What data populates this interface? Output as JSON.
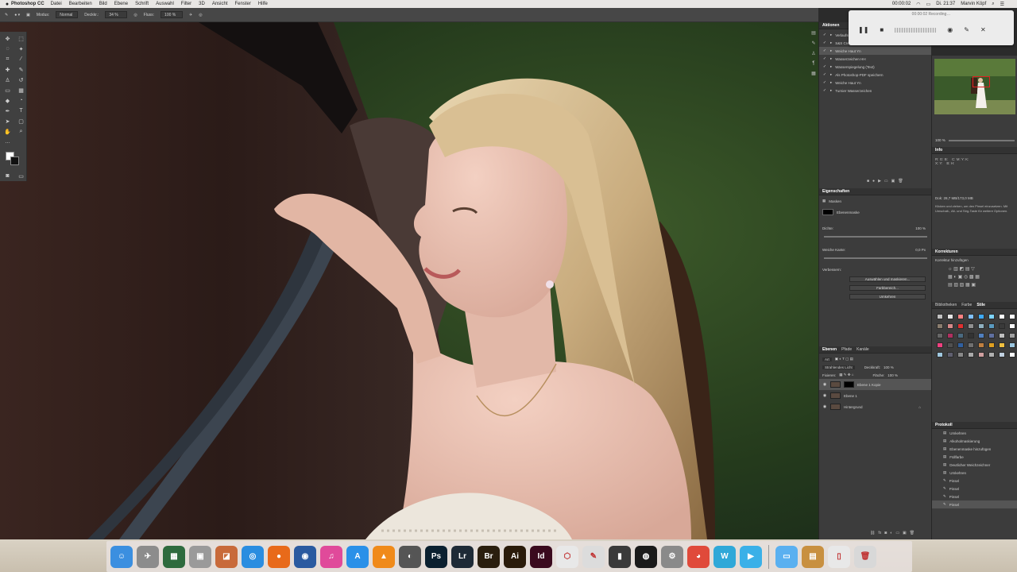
{
  "menubar": {
    "apple": "",
    "app_name": "Photoshop CC",
    "menus": [
      "Datei",
      "Bearbeiten",
      "Bild",
      "Ebene",
      "Schrift",
      "Auswahl",
      "Filter",
      "3D",
      "Ansicht",
      "Fenster",
      "Hilfe"
    ],
    "clock": "00:00:02",
    "time": "Di. 21:37",
    "user": "Marvin Köpf"
  },
  "optionsbar": {
    "modus_label": "Modus:",
    "modus_value": "Normal",
    "deckkraft_label": "Deckkr.:",
    "deckkraft_value": "34 %",
    "fluss_label": "Fluss:",
    "fluss_value": "100 %"
  },
  "recording": {
    "title": "00:00:02 Recording…"
  },
  "actions_panel": {
    "tab": "Aktionen",
    "items": [
      "Verlaufsumsetzung AR",
      "S&S Crema",
      "Weiche Haut Yn",
      "Wasserzeichen HH",
      "Wasserspiegelung (Text)",
      "Als Photoshop-PDF speichern",
      "Weiche Haut Yn",
      "Turnier Wasserzeichen"
    ]
  },
  "navigator": {
    "zoom": "100 %"
  },
  "info_panel": {
    "tab": "Info",
    "text": "Dok: 28,7 MB/173,0 MB",
    "hint": "Klicken und ziehen, um den Pinsel einzusetzen. Mit Umschalt-, Alt- und Strg-Taste für weitere Optionen."
  },
  "properties_panel": {
    "tab": "Eigenschaften",
    "subtitle": "Masken",
    "mask_label": "Ebenenmaske",
    "dichte_label": "Dichte:",
    "dichte_value": "100 %",
    "kante_label": "Weiche Kante:",
    "kante_value": "0,0 Px",
    "verbessern_label": "Verbessern:",
    "btn1": "Auswählen und maskieren...",
    "btn2": "Farbbereich...",
    "btn3": "Umkehren"
  },
  "corrections_panel": {
    "tab": "Korrekturen",
    "subtitle": "Korrektur hinzufügen"
  },
  "swatches_panel": {
    "tabs": [
      "Bibliotheken",
      "Farbe",
      "Stile"
    ],
    "colors": [
      "#c0c0c0",
      "#e6e6e6",
      "#ff8080",
      "#80c0ff",
      "#3fa9f5",
      "#7fd4ff",
      "#ffffff",
      "#ffffff",
      "#8a7d6e",
      "#d88888",
      "#e03030",
      "#909090",
      "#8fb0c0",
      "#5a9abf",
      "#3a3a3a",
      "#ffffff",
      "#666666",
      "#b03060",
      "#4a6a80",
      "#333333",
      "#5080c0",
      "#6070a0",
      "#c0c0c0",
      "#a0a0a0",
      "#f04080",
      "#505050",
      "#3060a0",
      "#707070",
      "#c08040",
      "#e0a020",
      "#f0c040",
      "#9cc7e0",
      "#a0c8e0",
      "#606070",
      "#888888",
      "#aaaaaa",
      "#d0a0a0",
      "#b0b0b0",
      "#c0d0e0",
      "#ffffff"
    ]
  },
  "layers_panel": {
    "tabs": [
      "Ebenen",
      "Pfade",
      "Kanäle"
    ],
    "filter_label": "Art",
    "blend_mode": "Strahlendes Licht",
    "deckkraft_label": "Deckkraft:",
    "deckkraft_value": "100 %",
    "fixieren_label": "Fixieren:",
    "flaeche_label": "Fläche:",
    "flaeche_value": "100 %",
    "layers": [
      {
        "name": "Ebene 1 Kopie",
        "selected": true,
        "mask": true
      },
      {
        "name": "Ebene 1",
        "selected": false,
        "mask": false
      },
      {
        "name": "Hintergrund",
        "selected": false,
        "mask": false
      }
    ]
  },
  "history_panel": {
    "tab": "Protokoll",
    "items": [
      "Umkehren",
      "Alkoholmaskierung",
      "Ebenenmaske hinzufügen",
      "Füllfarbe",
      "Deutlicher Weichzeichner",
      "Umkehren",
      "Pinsel",
      "Pinsel",
      "Pinsel",
      "Pinsel"
    ]
  },
  "dock": {
    "apps": [
      {
        "name": "finder",
        "label": "☺",
        "color": "#3b8fe0"
      },
      {
        "name": "launchpad",
        "label": "✈",
        "color": "#8c8c8c"
      },
      {
        "name": "mission-control",
        "label": "▦",
        "color": "#2e6b3e"
      },
      {
        "name": "photos-folder",
        "label": "▣",
        "color": "#9a9a9a"
      },
      {
        "name": "preview",
        "label": "◪",
        "color": "#c86a3a"
      },
      {
        "name": "safari",
        "label": "◎",
        "color": "#2a8de0"
      },
      {
        "name": "firefox",
        "label": "●",
        "color": "#e86a1a"
      },
      {
        "name": "thunderbird",
        "label": "◉",
        "color": "#2a5aa0"
      },
      {
        "name": "itunes",
        "label": "♫",
        "color": "#e04a9a"
      },
      {
        "name": "app-store",
        "label": "A",
        "color": "#2a90e8"
      },
      {
        "name": "vlc",
        "label": "▲",
        "color": "#f08a1a"
      },
      {
        "name": "camera",
        "label": "◐",
        "color": "#555555"
      },
      {
        "name": "photoshop",
        "label": "Ps",
        "color": "#0b2030"
      },
      {
        "name": "lightroom",
        "label": "Lr",
        "color": "#1e2a36"
      },
      {
        "name": "bridge",
        "label": "Br",
        "color": "#2a1e0e"
      },
      {
        "name": "illustrator",
        "label": "Ai",
        "color": "#2a1b0a"
      },
      {
        "name": "indesign",
        "label": "Id",
        "color": "#3a0a1e"
      },
      {
        "name": "acrobat",
        "label": "⬡",
        "color": "#e8e8e8"
      },
      {
        "name": "script-editor",
        "label": "✎",
        "color": "#dcdcdc"
      },
      {
        "name": "file-manager",
        "label": "▮",
        "color": "#3a3a3a"
      },
      {
        "name": "screen-recorder",
        "label": "◍",
        "color": "#1a1a1a"
      },
      {
        "name": "system-preferences",
        "label": "⚙",
        "color": "#8a8a8a"
      },
      {
        "name": "chrome",
        "label": "◕",
        "color": "#e04a3a"
      },
      {
        "name": "word",
        "label": "W",
        "color": "#2fa8d8"
      },
      {
        "name": "facetime",
        "label": "▶",
        "color": "#3ab0e8"
      },
      {
        "name": "folder",
        "label": "▭",
        "color": "#5ab0f0"
      },
      {
        "name": "archive",
        "label": "▤",
        "color": "#c89040"
      },
      {
        "name": "document",
        "label": "▯",
        "color": "#e8e8e8"
      },
      {
        "name": "trash",
        "label": "🗑",
        "color": "#d8d8d8"
      }
    ]
  }
}
